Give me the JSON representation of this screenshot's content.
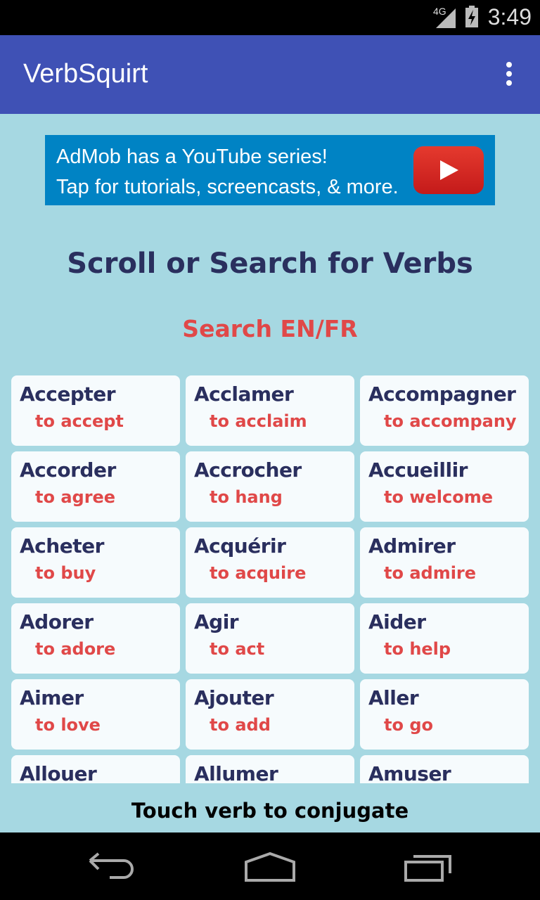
{
  "status_bar": {
    "network": "4G",
    "time": "3:49",
    "icons": [
      "signal-icon",
      "battery-charging-icon"
    ]
  },
  "app_bar": {
    "title": "VerbSquirt",
    "menu_icon": "overflow-menu-icon"
  },
  "ad": {
    "line1": "AdMob has a YouTube series!",
    "line2": "Tap for tutorials, screencasts, & more.",
    "icon": "youtube-play-icon"
  },
  "heading": "Scroll or Search for Verbs",
  "search_label": "Search EN/FR",
  "verbs": [
    {
      "fr": "Accepter",
      "en": "to accept"
    },
    {
      "fr": "Acclamer",
      "en": "to acclaim"
    },
    {
      "fr": "Accompagner",
      "en": "to accompany"
    },
    {
      "fr": "Accorder",
      "en": "to agree"
    },
    {
      "fr": "Accrocher",
      "en": "to hang"
    },
    {
      "fr": "Accueillir",
      "en": "to welcome"
    },
    {
      "fr": "Acheter",
      "en": "to buy"
    },
    {
      "fr": "Acquérir",
      "en": "to acquire"
    },
    {
      "fr": "Admirer",
      "en": "to admire"
    },
    {
      "fr": "Adorer",
      "en": "to adore"
    },
    {
      "fr": "Agir",
      "en": "to act"
    },
    {
      "fr": "Aider",
      "en": "to help"
    },
    {
      "fr": "Aimer",
      "en": "to love"
    },
    {
      "fr": "Ajouter",
      "en": "to add"
    },
    {
      "fr": "Aller",
      "en": "to go"
    },
    {
      "fr": "Allouer",
      "en": ""
    },
    {
      "fr": "Allumer",
      "en": ""
    },
    {
      "fr": "Amuser",
      "en": ""
    }
  ],
  "footer": "Touch verb to conjugate",
  "colors": {
    "app_bar": "#3f51b5",
    "background": "#a6d8e2",
    "verb": "#2a2f5e",
    "translation": "#e04848",
    "ad": "#0083c4"
  }
}
